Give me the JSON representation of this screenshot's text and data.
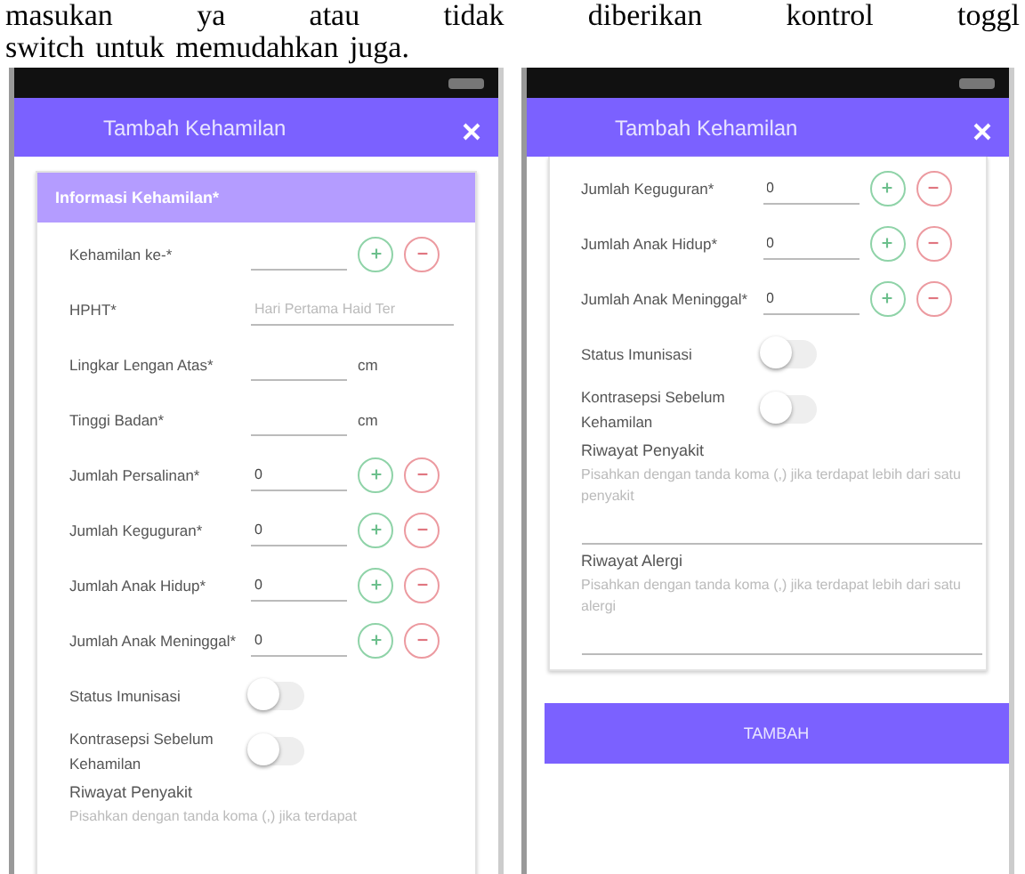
{
  "document_text": [
    "masukan ya atau tidak diberikan kontrol toggl",
    "switch untuk memudahkan juga."
  ],
  "screens": [
    {
      "header": {
        "title": "Tambah Kehamilan"
      },
      "card_title": "Informasi Kehamilan*",
      "rows": [
        {
          "kind": "counter",
          "label": "Kehamilan ke-*",
          "value": ""
        },
        {
          "kind": "text",
          "label": "HPHT*",
          "placeholder": "Hari Pertama Haid Ter"
        },
        {
          "kind": "unit",
          "label": "Lingkar Lengan Atas*",
          "unit": "cm"
        },
        {
          "kind": "unit",
          "label": "Tinggi Badan*",
          "unit": "cm"
        },
        {
          "kind": "counter",
          "label": "Jumlah Persalinan*",
          "value": "0"
        },
        {
          "kind": "counter",
          "label": "Jumlah Keguguran*",
          "value": "0"
        },
        {
          "kind": "counter",
          "label": "Jumlah Anak Hidup*",
          "value": "0"
        },
        {
          "kind": "counter",
          "label": "Jumlah Anak Meninggal*",
          "value": "0"
        },
        {
          "kind": "toggle",
          "label": "Status Imunisasi",
          "on": false
        },
        {
          "kind": "toggle",
          "label": "Kontrasepsi Sebelum Kehamilan",
          "on": false
        },
        {
          "kind": "textarea",
          "label": "Riwayat Penyakit",
          "placeholder": "Pisahkan dengan tanda koma (,) jika terdapat"
        }
      ]
    },
    {
      "header": {
        "title": "Tambah Kehamilan"
      },
      "rows": [
        {
          "kind": "counter",
          "label": "Jumlah Keguguran*",
          "value": "0"
        },
        {
          "kind": "counter",
          "label": "Jumlah Anak Hidup*",
          "value": "0"
        },
        {
          "kind": "counter",
          "label": "Jumlah Anak Meninggal*",
          "value": "0"
        },
        {
          "kind": "toggle",
          "label": "Status Imunisasi",
          "on": false
        },
        {
          "kind": "toggle",
          "label": "Kontrasepsi Sebelum Kehamilan",
          "on": false
        },
        {
          "kind": "textarea",
          "label": "Riwayat Penyakit",
          "placeholder": "Pisahkan dengan tanda koma (,) jika terdapat lebih dari satu penyakit"
        },
        {
          "kind": "textarea",
          "label": "Riwayat Alergi",
          "placeholder": "Pisahkan dengan tanda koma (,) jika terdapat lebih dari satu alergi"
        }
      ],
      "button": "TAMBAH"
    }
  ]
}
